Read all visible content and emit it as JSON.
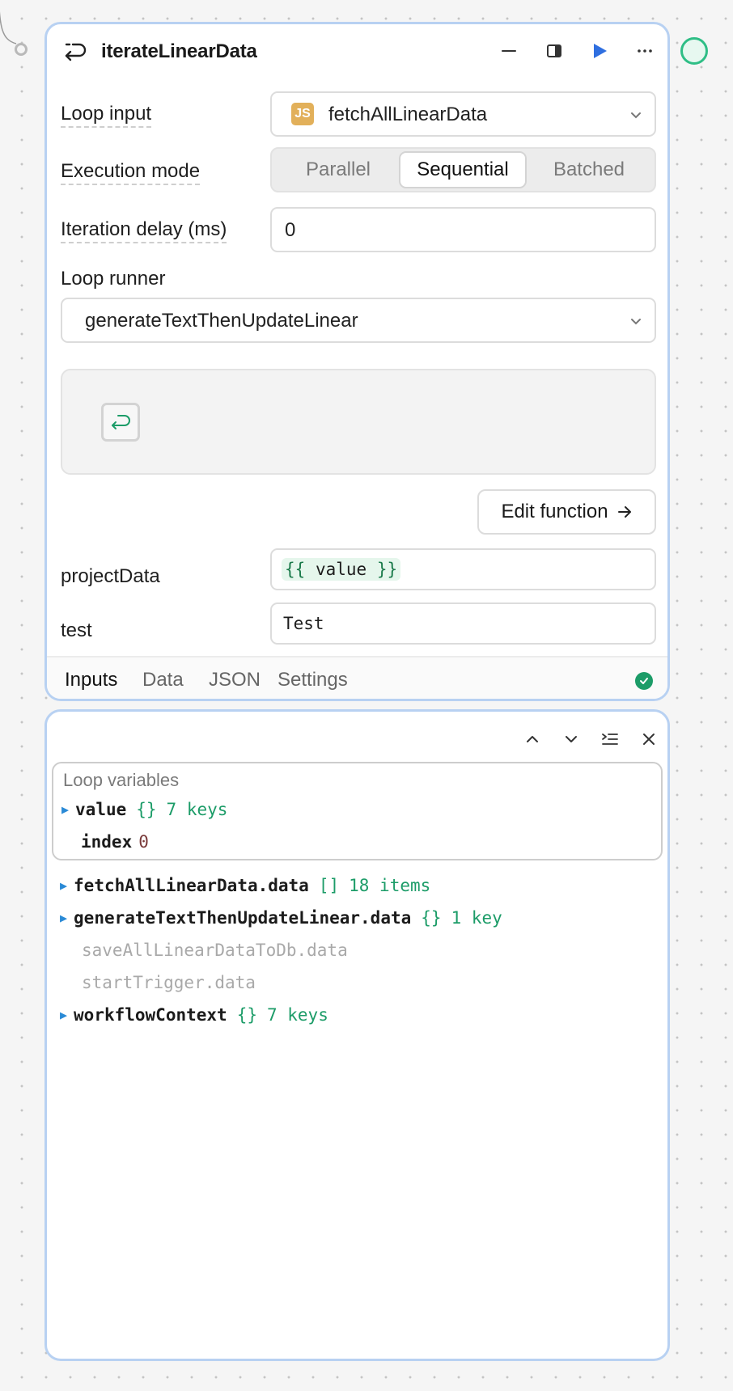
{
  "node": {
    "title": "iterateLinearData",
    "icons": {
      "loop": "loop-arrow-icon",
      "minimize": "minimize-icon",
      "panel": "side-panel-icon",
      "run": "play-icon",
      "more": "more-horizontal-icon"
    },
    "loop_input": {
      "label": "Loop input",
      "badge": "JS",
      "value": "fetchAllLinearData"
    },
    "execution_mode": {
      "label": "Execution mode",
      "options": [
        "Parallel",
        "Sequential",
        "Batched"
      ],
      "selected": "Sequential"
    },
    "iteration_delay": {
      "label": "Iteration delay (ms)",
      "value": "0"
    },
    "loop_runner": {
      "label": "Loop runner",
      "value": "generateTextThenUpdateLinear"
    },
    "edit_function_label": "Edit function",
    "params": [
      {
        "name": "projectData",
        "open": "{{",
        "value": " value ",
        "close": "}}"
      },
      {
        "name": "test",
        "value": "Test"
      }
    ],
    "tabs": [
      "Inputs",
      "Data",
      "JSON",
      "Settings"
    ],
    "active_tab": "Inputs",
    "status_color": "#1c9c68"
  },
  "vars_panel": {
    "icons": {
      "up": "chevron-up-icon",
      "down": "chevron-down-icon",
      "indent": "list-indent-icon",
      "close": "close-icon"
    },
    "loop_variables": {
      "title": "Loop variables",
      "items": [
        {
          "key": "value",
          "type": "{}",
          "count": "7 keys"
        },
        {
          "key": "index",
          "value": "0"
        }
      ]
    },
    "tree": [
      {
        "key": "fetchAllLinearData.data",
        "type": "[]",
        "count": "18 items"
      },
      {
        "key": "generateTextThenUpdateLinear.data",
        "type": "{}",
        "count": "1 key"
      },
      {
        "key": "saveAllLinearDataToDb.data"
      },
      {
        "key": "startTrigger.data"
      },
      {
        "key": "workflowContext",
        "type": "{}",
        "count": "7 keys"
      }
    ]
  },
  "colors": {
    "accent_border": "#b8d1f2",
    "green": "#1c9c68",
    "play_blue": "#2f6fe0",
    "js_badge": "#e2b05a"
  }
}
